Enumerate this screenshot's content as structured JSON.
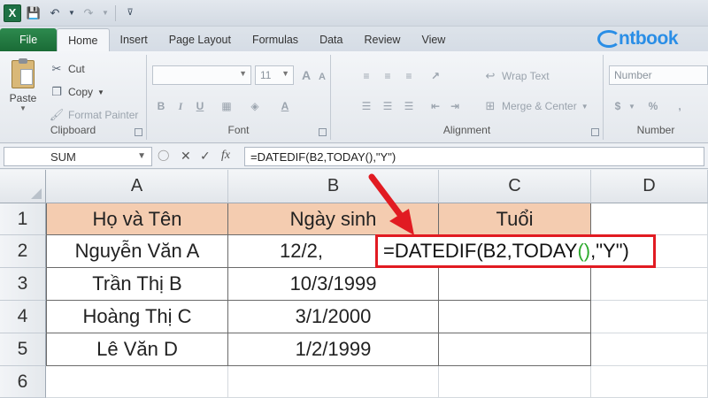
{
  "app": {
    "logo_letter": "X",
    "brand_text": "ntbook",
    "accent_color": "#1e7145",
    "brand_color": "#2a8ee6"
  },
  "quick_access": {
    "save_icon": "save-icon",
    "undo_icon": "undo-icon",
    "redo_icon": "redo-icon"
  },
  "tabs": [
    {
      "label": "File"
    },
    {
      "label": "Home"
    },
    {
      "label": "Insert"
    },
    {
      "label": "Page Layout"
    },
    {
      "label": "Formulas"
    },
    {
      "label": "Data"
    },
    {
      "label": "Review"
    },
    {
      "label": "View"
    }
  ],
  "ribbon": {
    "clipboard": {
      "label": "Clipboard",
      "paste": "Paste",
      "cut": "Cut",
      "copy": "Copy",
      "format_painter": "Format Painter"
    },
    "font": {
      "label": "Font",
      "font_name": "",
      "font_size": "11",
      "bold": "B",
      "italic": "I",
      "underline": "U",
      "grow": "A",
      "shrink": "A"
    },
    "alignment": {
      "label": "Alignment",
      "wrap_text": "Wrap Text",
      "merge_center": "Merge & Center"
    },
    "number": {
      "label": "Number",
      "format": "Number",
      "dollar": "$",
      "percent": "%",
      "comma": ","
    }
  },
  "formula_bar": {
    "name_box": "SUM",
    "fx": "fx",
    "formula": "=DATEDIF(B2,TODAY(),\"Y\")"
  },
  "grid": {
    "columns": [
      "A",
      "B",
      "C",
      "D"
    ],
    "rows": [
      "1",
      "2",
      "3",
      "4",
      "5",
      "6"
    ],
    "header": [
      "Họ và Tên",
      "Ngày sinh",
      "Tuổi"
    ],
    "data": [
      [
        "Nguyễn Văn A",
        "12/2,",
        ""
      ],
      [
        "Trần Thị B",
        "10/3/1999",
        ""
      ],
      [
        "Hoàng Thị C",
        "3/1/2000",
        ""
      ],
      [
        "Lê Văn D",
        "1/2/1999",
        ""
      ]
    ],
    "header_fill": "#f4ccb0"
  },
  "annotation": {
    "formula_pre": "=DATEDIF(B2,TODAY",
    "paren": "()",
    "formula_post": ",\"Y\")",
    "border_color": "#e11b22"
  }
}
